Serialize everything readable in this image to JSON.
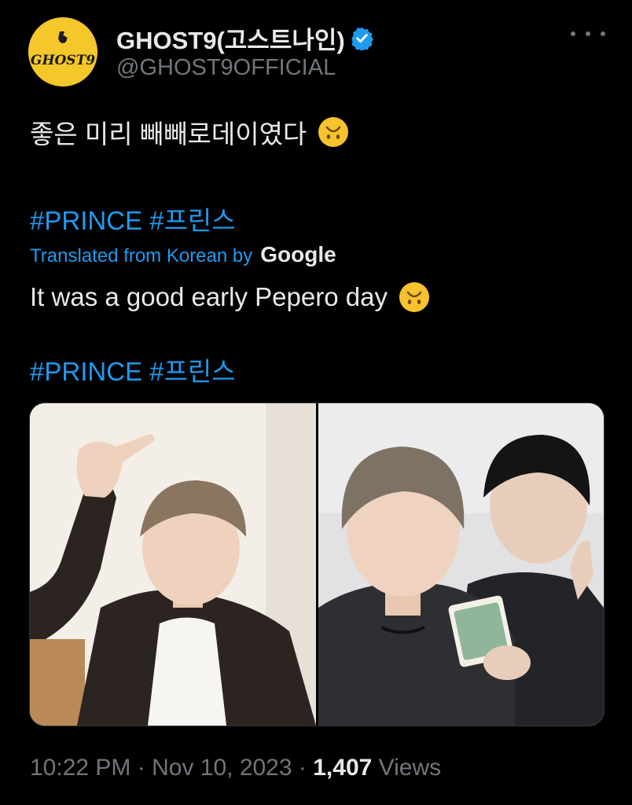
{
  "header": {
    "display_name": "GHOST9(고스트나인)",
    "handle": "@GHOST9OFFICIAL",
    "avatar_text": "GHOST9",
    "verified_icon": "verified-badge-icon",
    "more_icon": "more-options-icon"
  },
  "tweet": {
    "text": "좋은 미리 빼빼로데이였다",
    "emoji_icon": "upside-down-face-emoji",
    "hashtags": [
      "#PRINCE",
      "#프린스"
    ]
  },
  "translation": {
    "label": "Translated from Korean by",
    "provider": "Google",
    "text": "It was a good early Pepero day",
    "hashtags": [
      "#PRINCE",
      "#프린스"
    ]
  },
  "meta": {
    "time": "10:22 PM",
    "separator": " · ",
    "date": "Nov 10, 2023",
    "views_count": "1,407",
    "views_label": "Views"
  },
  "colors": {
    "background": "#000000",
    "text": "#e7e9ea",
    "secondary": "#71767b",
    "link": "#1d9bf0",
    "avatar": "#f4c72a"
  }
}
